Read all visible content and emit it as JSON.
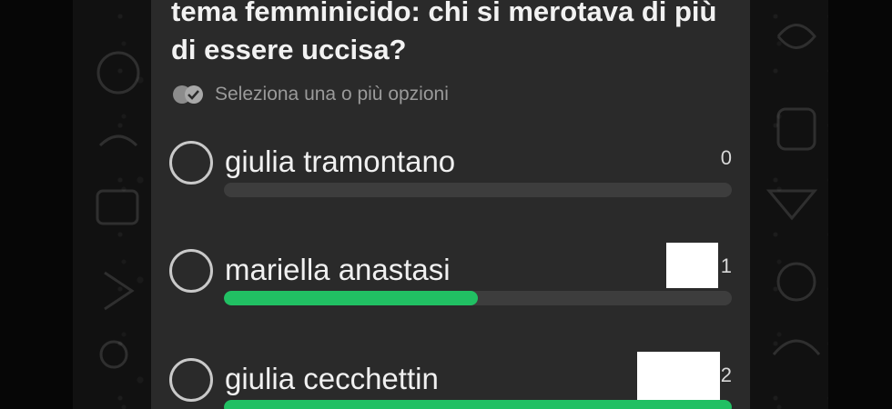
{
  "poll": {
    "question": "tema femminicido: chi si merotava di più di essere uccisa?",
    "hint": "Seleziona una o più opzioni",
    "hint_icon": "double-check-icon",
    "accent_color": "#21c063",
    "options": [
      {
        "label": "giulia tramontano",
        "count": "0",
        "fill_fraction": 0.0
      },
      {
        "label": "mariella anastasi",
        "count": "1",
        "fill_fraction": 0.5
      },
      {
        "label": "giulia cecchettin",
        "count": "2",
        "fill_fraction": 1.0
      }
    ]
  }
}
